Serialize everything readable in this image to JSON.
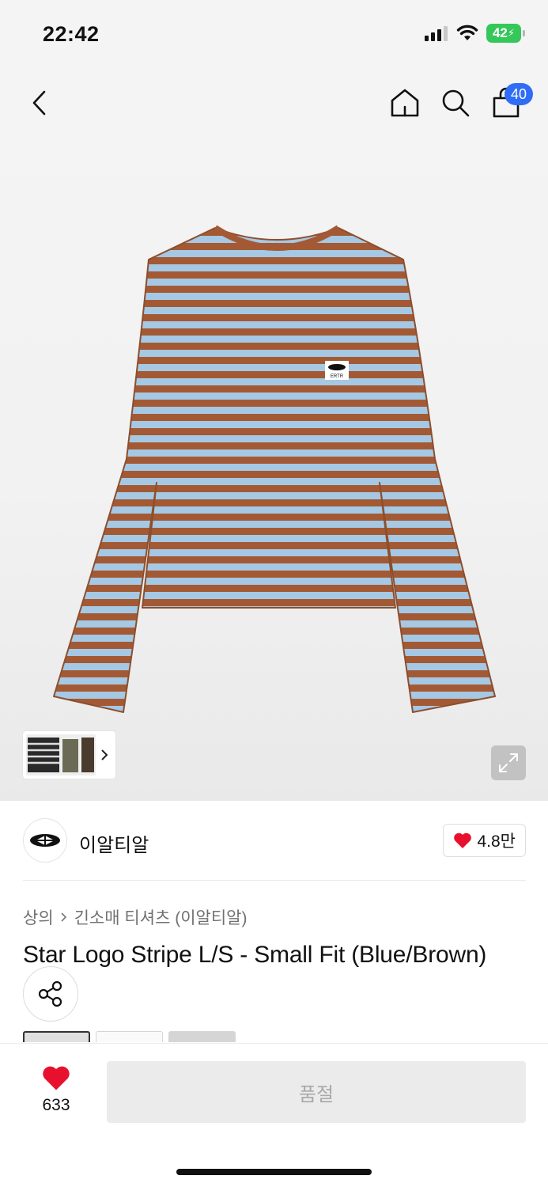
{
  "status_bar": {
    "time": "22:42",
    "battery": "42"
  },
  "header": {
    "cart_count": "40"
  },
  "brand": {
    "name": "이알티알",
    "likes": "4.8만"
  },
  "breadcrumb": {
    "category": "상의",
    "subcategory": "긴소매 티셔츠 (이알티알)"
  },
  "product": {
    "title": "Star Logo Stripe L/S - Small Fit (Blue/Brown)",
    "chest_logo_text": "ERTR",
    "stripe_colors": {
      "blue": "#a5c8e4",
      "brown": "#a35a34"
    }
  },
  "bottom_bar": {
    "wish_count": "633",
    "buy_label": "품절"
  },
  "colors": {
    "accent_badge": "#2f6df6",
    "heart": "#e8112d",
    "battery_green": "#34c759"
  }
}
